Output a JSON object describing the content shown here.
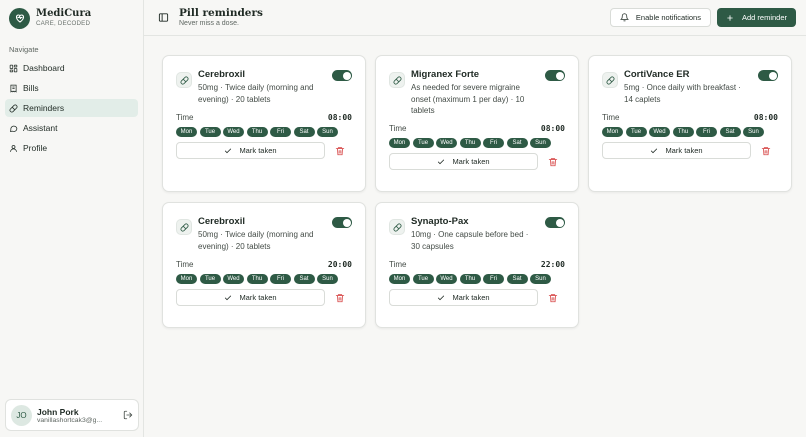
{
  "app": {
    "name": "MediCura",
    "tagline": "CARE, DECODED"
  },
  "sidebar": {
    "heading": "Navigate",
    "items": [
      {
        "label": "Dashboard",
        "icon": "dashboard-icon",
        "active": false
      },
      {
        "label": "Bills",
        "icon": "receipt-icon",
        "active": false
      },
      {
        "label": "Reminders",
        "icon": "pill-icon",
        "active": true
      },
      {
        "label": "Assistant",
        "icon": "chat-icon",
        "active": false
      },
      {
        "label": "Profile",
        "icon": "user-icon",
        "active": false
      }
    ]
  },
  "user": {
    "initials": "JO",
    "name": "John Pork",
    "email": "vanillashortcak3@g..."
  },
  "header": {
    "title": "Pill reminders",
    "subtitle": "Never miss a dose.",
    "notify_label": "Enable notifications",
    "add_label": "Add reminder"
  },
  "card_labels": {
    "time": "Time",
    "mark_taken": "Mark taken"
  },
  "reminders": [
    {
      "name": "Cerebroxil",
      "description": "50mg · Twice daily (morning and evening) · 20 tablets",
      "time": "08:00",
      "enabled": true,
      "days": [
        "Mon",
        "Tue",
        "Wed",
        "Thu",
        "Fri",
        "Sat",
        "Sun"
      ]
    },
    {
      "name": "Migranex Forte",
      "description": "As needed for severe migraine onset (maximum 1 per day) · 10 tablets",
      "time": "08:00",
      "enabled": true,
      "days": [
        "Mon",
        "Tue",
        "Wed",
        "Thu",
        "Fri",
        "Sat",
        "Sun"
      ]
    },
    {
      "name": "CortiVance ER",
      "description": "5mg · Once daily with breakfast · 14 caplets",
      "time": "08:00",
      "enabled": true,
      "days": [
        "Mon",
        "Tue",
        "Wed",
        "Thu",
        "Fri",
        "Sat",
        "Sun"
      ]
    },
    {
      "name": "Cerebroxil",
      "description": "50mg · Twice daily (morning and evening) · 20 tablets",
      "time": "20:00",
      "enabled": true,
      "days": [
        "Mon",
        "Tue",
        "Wed",
        "Thu",
        "Fri",
        "Sat",
        "Sun"
      ]
    },
    {
      "name": "Synapto-Pax",
      "description": "10mg · One capsule before bed · 30 capsules",
      "time": "22:00",
      "enabled": true,
      "days": [
        "Mon",
        "Tue",
        "Wed",
        "Thu",
        "Fri",
        "Sat",
        "Sun"
      ]
    }
  ],
  "colors": {
    "accent": "#2e5a45",
    "danger": "#d64545",
    "active_nav": "#e2ede8"
  }
}
